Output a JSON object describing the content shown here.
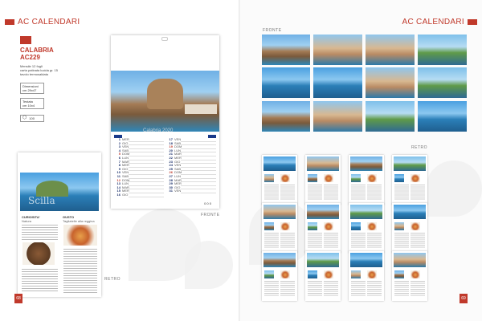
{
  "header": {
    "title_left": "AC CALENDARI",
    "title_right": "AC CALENDARI"
  },
  "product": {
    "name": "CALABRIA",
    "code": "AC229",
    "desc": [
      "Mensile 12 fogli",
      "carta patinata lucida gr. 15",
      "tavolo termosaldata"
    ],
    "dim_label": "Dimensioni",
    "dim_value": "cm 29x47",
    "testata_label": "Testata",
    "testata_value": "cm 10x4",
    "pack": "100"
  },
  "calendar": {
    "watermark": "Calabria 2020",
    "col1": [
      {
        "n": "1",
        "d": "MER"
      },
      {
        "n": "2",
        "d": "GIO"
      },
      {
        "n": "3",
        "d": "VEN"
      },
      {
        "n": "4",
        "d": "SAB"
      },
      {
        "n": "5",
        "d": "DOM"
      },
      {
        "n": "6",
        "d": "LUN"
      },
      {
        "n": "7",
        "d": "MAR"
      },
      {
        "n": "8",
        "d": "MER"
      },
      {
        "n": "9",
        "d": "GIO"
      },
      {
        "n": "10",
        "d": "VEN"
      },
      {
        "n": "11",
        "d": "SAB"
      },
      {
        "n": "12",
        "d": "DOM"
      },
      {
        "n": "13",
        "d": "LUN"
      },
      {
        "n": "14",
        "d": "MAR"
      },
      {
        "n": "15",
        "d": "MER"
      },
      {
        "n": "16",
        "d": "GIO"
      }
    ],
    "col2": [
      {
        "n": "17",
        "d": "VEN"
      },
      {
        "n": "18",
        "d": "SAB"
      },
      {
        "n": "19",
        "d": "DOM"
      },
      {
        "n": "20",
        "d": "LUN"
      },
      {
        "n": "21",
        "d": "MAR"
      },
      {
        "n": "22",
        "d": "MER"
      },
      {
        "n": "23",
        "d": "GIO"
      },
      {
        "n": "24",
        "d": "VEN"
      },
      {
        "n": "25",
        "d": "SAB"
      },
      {
        "n": "26",
        "d": "DOM"
      },
      {
        "n": "27",
        "d": "LUN"
      },
      {
        "n": "28",
        "d": "MAR"
      },
      {
        "n": "29",
        "d": "MER"
      },
      {
        "n": "30",
        "d": "GIO"
      },
      {
        "n": "31",
        "d": "VEN"
      }
    ],
    "footer": "0 0 0"
  },
  "back": {
    "watermark": "Scilla",
    "left_title": "CURIOSITA'",
    "left_sub": "Natura",
    "right_title": "GUSTO",
    "right_sub": "Tagliatelle alla reggina"
  },
  "captions": {
    "fronte_left": "FRONTE",
    "retro_left": "RETRO",
    "fronte_right": "FRONTE",
    "retro_right": "RETRO"
  },
  "page_numbers": {
    "left": "68",
    "right": "69"
  }
}
